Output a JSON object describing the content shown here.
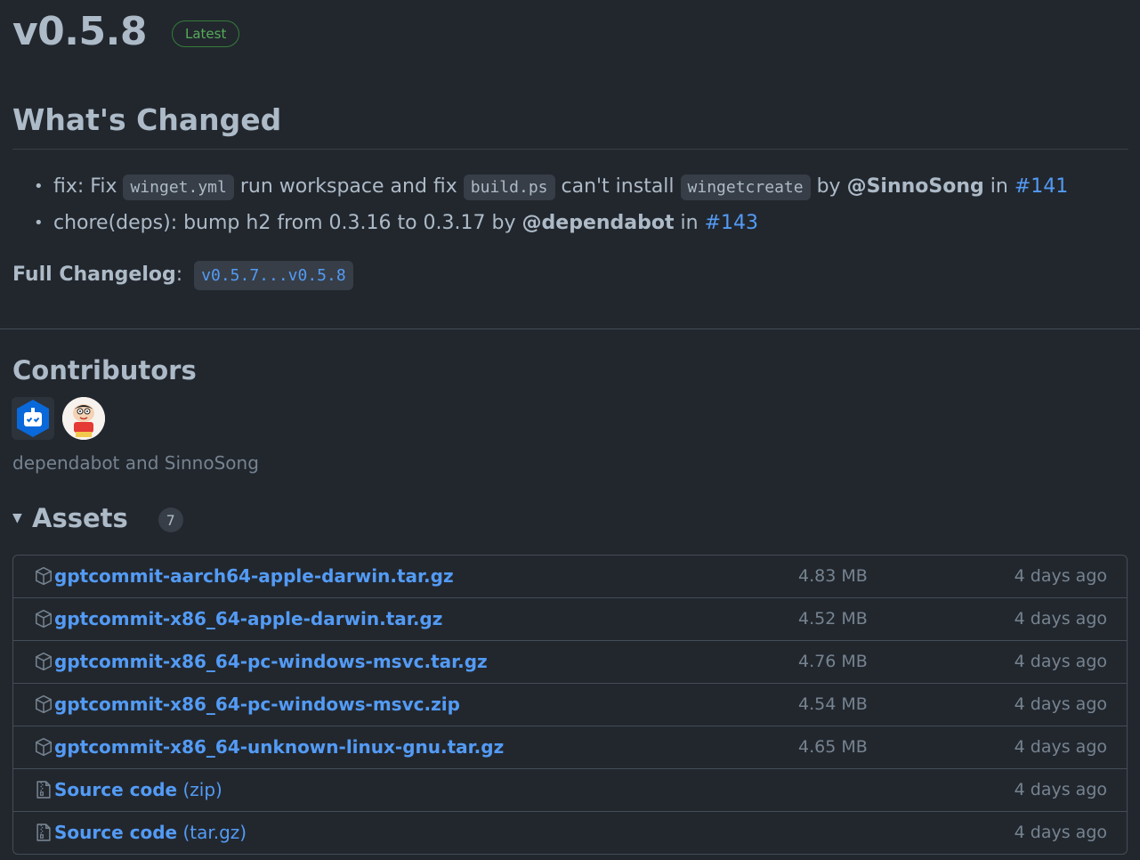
{
  "release": {
    "tag": "v0.5.8",
    "badge": "Latest"
  },
  "whats_changed": {
    "heading": "What's Changed",
    "items": [
      {
        "text_1": "fix: Fix ",
        "code_1": "winget.yml",
        "text_2": " run workspace and fix ",
        "code_2": "build.ps",
        "text_3": " can't install ",
        "code_3": "wingetcreate",
        "by": " by ",
        "author": "@SinnoSong",
        "in": " in ",
        "pr": "#141"
      },
      {
        "text_1": "chore(deps): bump h2 from 0.3.16 to 0.3.17",
        "by": " by ",
        "author": "@dependabot",
        "in": " in ",
        "pr": "#143"
      }
    ],
    "changelog_label": "Full Changelog",
    "changelog_colon": ": ",
    "changelog_range": "v0.5.7...v0.5.8"
  },
  "contributors": {
    "heading": "Contributors",
    "names": "dependabot and SinnoSong",
    "avatars": [
      "dependabot",
      "SinnoSong"
    ]
  },
  "assets": {
    "heading": "Assets",
    "count": "7",
    "items": [
      {
        "name": "gptcommit-aarch64-apple-darwin.tar.gz",
        "suffix": "",
        "size": "4.83 MB",
        "date": "4 days ago",
        "icon": "package-icon"
      },
      {
        "name": "gptcommit-x86_64-apple-darwin.tar.gz",
        "suffix": "",
        "size": "4.52 MB",
        "date": "4 days ago",
        "icon": "package-icon"
      },
      {
        "name": "gptcommit-x86_64-pc-windows-msvc.tar.gz",
        "suffix": "",
        "size": "4.76 MB",
        "date": "4 days ago",
        "icon": "package-icon"
      },
      {
        "name": "gptcommit-x86_64-pc-windows-msvc.zip",
        "suffix": "",
        "size": "4.54 MB",
        "date": "4 days ago",
        "icon": "package-icon"
      },
      {
        "name": "gptcommit-x86_64-unknown-linux-gnu.tar.gz",
        "suffix": "",
        "size": "4.65 MB",
        "date": "4 days ago",
        "icon": "package-icon"
      },
      {
        "name": "Source code",
        "suffix": " (zip)",
        "size": "",
        "date": "4 days ago",
        "icon": "file-zip-icon"
      },
      {
        "name": "Source code",
        "suffix": " (tar.gz)",
        "size": "",
        "date": "4 days ago",
        "icon": "file-zip-icon"
      }
    ]
  },
  "colors": {
    "background": "#22272e",
    "link": "#539bf5",
    "badge_green": "#57ab5a",
    "muted": "#768390",
    "border": "#444c56"
  }
}
